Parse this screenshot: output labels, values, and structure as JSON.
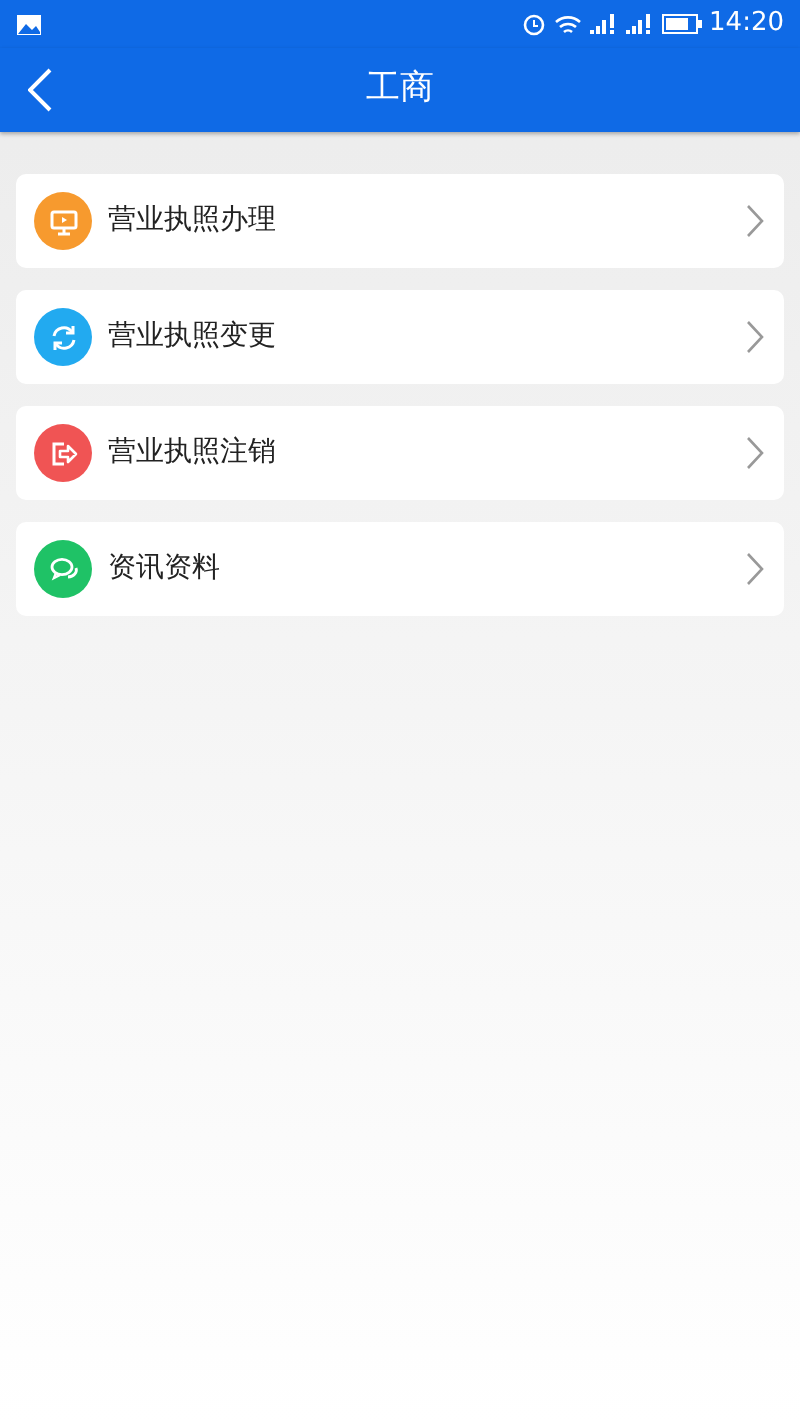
{
  "status_bar": {
    "time": "14:20"
  },
  "header": {
    "title": "工商"
  },
  "menu": [
    {
      "label": "营业执照办理",
      "kind": "monitor",
      "color": "#f79a2e"
    },
    {
      "label": "营业执照变更",
      "kind": "refresh",
      "color": "#22aaf0"
    },
    {
      "label": "营业执照注销",
      "kind": "exit",
      "color": "#f05454"
    },
    {
      "label": "资讯资料",
      "kind": "chat",
      "color": "#1fc266"
    }
  ]
}
